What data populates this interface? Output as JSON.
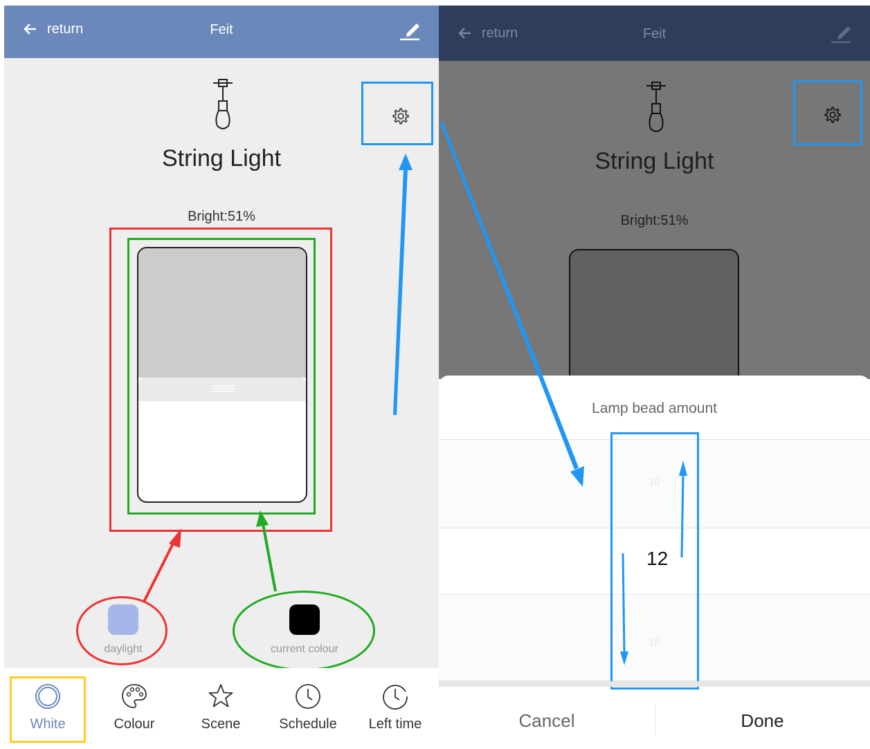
{
  "left_screen": {
    "header": {
      "back_label": "return",
      "title": "Feit"
    },
    "device": {
      "name": "String Light",
      "brightness": "Bright:51%",
      "brightness_value": 0.51
    },
    "presets": {
      "daylight_label": "daylight",
      "current_label": "current colour",
      "daylight_color": "#a5b6e8",
      "current_color": "#000000"
    },
    "tabs": [
      {
        "label": "White",
        "icon": "ring-icon"
      },
      {
        "label": "Colour",
        "icon": "palette-icon"
      },
      {
        "label": "Scene",
        "icon": "star-icon"
      },
      {
        "label": "Schedule",
        "icon": "clock-icon"
      },
      {
        "label": "Left time",
        "icon": "timer-icon"
      }
    ],
    "active_tab": "White"
  },
  "right_screen": {
    "header": {
      "back_label": "return",
      "title": "Feit"
    },
    "device": {
      "name": "String Light",
      "brightness": "Bright:51%"
    },
    "sheet": {
      "title": "Lamp bead amount",
      "options": [
        "10",
        "12",
        "15"
      ],
      "selected": "12",
      "cancel_label": "Cancel",
      "done_label": "Done"
    }
  },
  "colors": {
    "header": "#6b88bb",
    "header_dimmed": "#2e3d5a",
    "annotation_red": "#ee3333",
    "annotation_green": "#22aa22",
    "annotation_blue": "#2196f3",
    "annotation_yellow": "#ffcc22"
  }
}
